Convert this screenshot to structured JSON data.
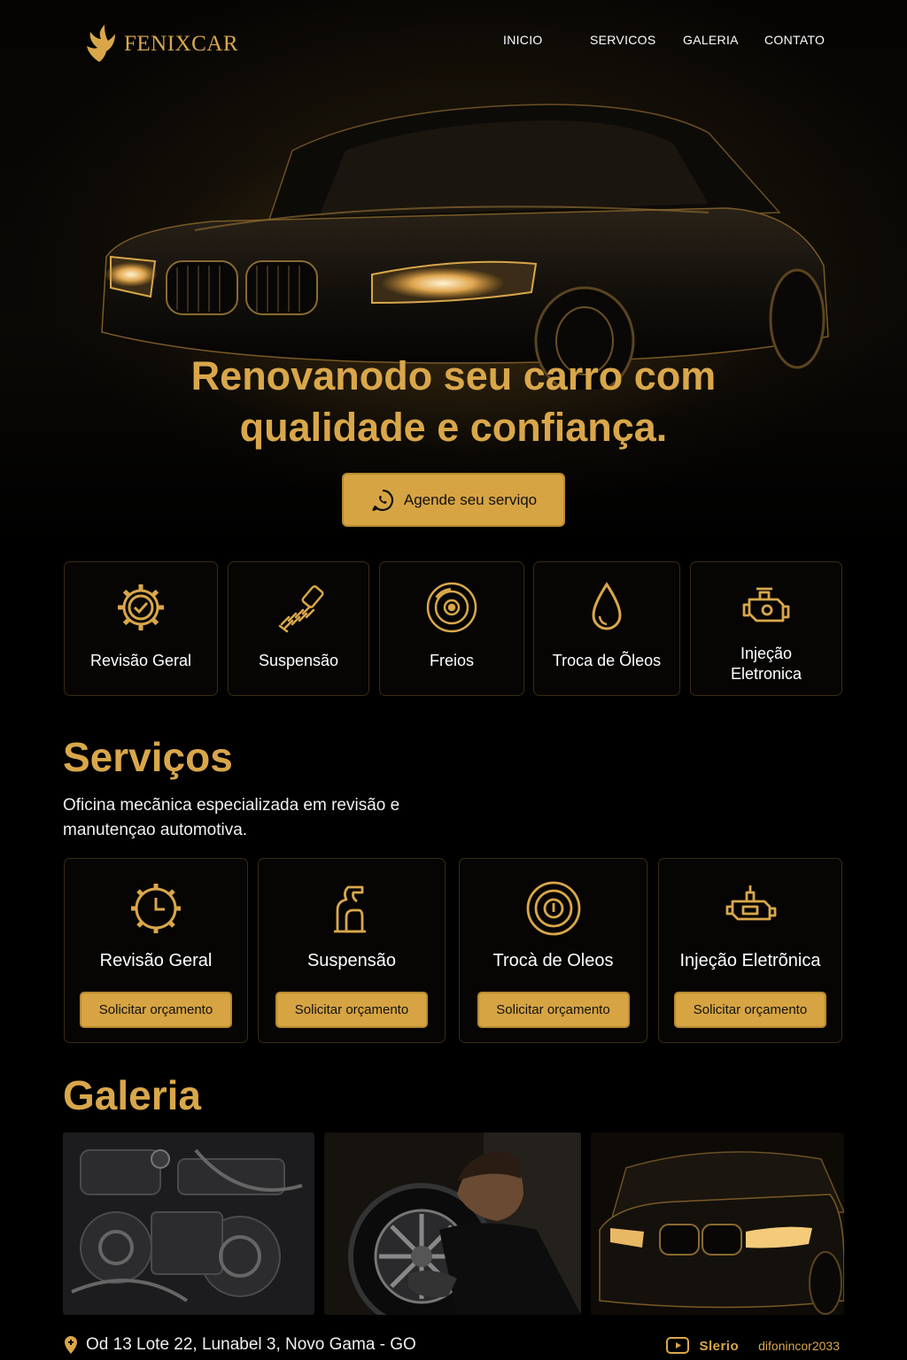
{
  "brand": {
    "name": "FENIXCAR"
  },
  "nav": [
    {
      "label": "INICIO"
    },
    {
      "label": "SERVICOS"
    },
    {
      "label": "GALERIA"
    },
    {
      "label": "CONTATO"
    }
  ],
  "hero": {
    "title_line1": "Renovanodo seu carro com",
    "title_line2": "qualidade e confiança.",
    "cta_label": "Agende seu serviqo",
    "cta_icon": "whatsapp-icon"
  },
  "features": [
    {
      "label": "Revisão Geral",
      "icon": "gear-check-icon"
    },
    {
      "label": "Suspensão",
      "icon": "spring-icon"
    },
    {
      "label": "Freios",
      "icon": "brake-disc-icon"
    },
    {
      "label": "Troca de Õleos",
      "icon": "oil-drop-icon"
    },
    {
      "label_line1": "Injeção",
      "label_line2": "Eletronica",
      "icon": "engine-icon"
    }
  ],
  "services": {
    "title": "Serviços",
    "description_line1": "Oficina mecãnica especializada em revisão e",
    "description_line2": "manutençao automotiva.",
    "cards": [
      {
        "name": "Revisão Geral",
        "button": "Solicitar orçamento",
        "icon": "gear-clock-icon"
      },
      {
        "name": "Suspensão",
        "button": "Solicitar orçamento",
        "icon": "suspension-icon"
      },
      {
        "name": "Trocà de Oleos",
        "button": "Solicitar orçamento",
        "icon": "gauge-icon"
      },
      {
        "name": "Injeção Eletrõnica",
        "button": "Solicitar orçamento",
        "icon": "engine-icon"
      }
    ]
  },
  "gallery": {
    "title": "Galeria",
    "images": [
      {
        "subject": "engine-photo"
      },
      {
        "subject": "mechanic-wheel-photo"
      },
      {
        "subject": "car-front-photo"
      }
    ]
  },
  "footer": {
    "address": "Od 13 Lote 22, Lunabel 3, Novo Gama - GO",
    "social_label": "Slerio",
    "social_handle": "difonincor2033"
  },
  "colors": {
    "accent": "#d9a74a",
    "button": "#d7a443",
    "background": "#000000",
    "card_border": "#3a2c12"
  }
}
